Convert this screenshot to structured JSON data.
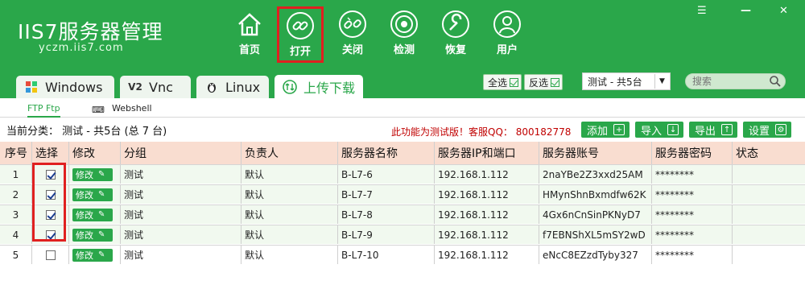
{
  "app": {
    "logo_main": "IIS7服务器管理",
    "logo_sub": "yczm.iis7.com"
  },
  "nav": [
    {
      "label": "首页",
      "icon": "home-icon"
    },
    {
      "label": "打开",
      "icon": "link-icon"
    },
    {
      "label": "关闭",
      "icon": "broken-link-icon"
    },
    {
      "label": "检测",
      "icon": "target-icon"
    },
    {
      "label": "恢复",
      "icon": "wrench-icon"
    },
    {
      "label": "用户",
      "icon": "user-icon"
    }
  ],
  "window": {
    "menu": "☰",
    "minimize": "—",
    "close": "✕"
  },
  "tabs": [
    {
      "label": "Windows",
      "icon": "windows-icon"
    },
    {
      "label": "Vnc",
      "icon": "vnc-icon"
    },
    {
      "label": "Linux",
      "icon": "linux-icon"
    },
    {
      "label": "上传下载",
      "icon": "upload-download-icon"
    }
  ],
  "toolbar": {
    "select_all": "全选",
    "invert": "反选",
    "group_select": "测试 - 共5台",
    "search_placeholder": "搜索"
  },
  "subtabs": [
    {
      "label": "FTP  Ftp"
    },
    {
      "label": "Webshell"
    }
  ],
  "info": {
    "category": "当前分类：  测试 - 共5台 (总 7 台)",
    "notice": "此功能为测试版！客服QQ：  800182778"
  },
  "actions": [
    {
      "label": "添加",
      "icon": "+"
    },
    {
      "label": "导入",
      "icon": "↓"
    },
    {
      "label": "导出",
      "icon": "↑"
    },
    {
      "label": "设置",
      "icon": "⚙"
    }
  ],
  "columns": [
    "序号",
    "选择",
    "修改",
    "分组",
    "负责人",
    "服务器名称",
    "服务器IP和端口",
    "服务器账号",
    "服务器密码",
    "状态"
  ],
  "edit_label": "修改",
  "rows": [
    {
      "num": "1",
      "checked": true,
      "group": "测试",
      "owner": "默认",
      "name": "B-L7-6",
      "ip": "192.168.1.112",
      "account": "2naYBe2Z3xxd25AM",
      "password": "********",
      "status": ""
    },
    {
      "num": "2",
      "checked": true,
      "group": "测试",
      "owner": "默认",
      "name": "B-L7-7",
      "ip": "192.168.1.112",
      "account": "HMynShnBxmdfw62K",
      "password": "********",
      "status": ""
    },
    {
      "num": "3",
      "checked": true,
      "group": "测试",
      "owner": "默认",
      "name": "B-L7-8",
      "ip": "192.168.1.112",
      "account": "4Gx6nCnSinPKNyD7",
      "password": "********",
      "status": ""
    },
    {
      "num": "4",
      "checked": true,
      "group": "测试",
      "owner": "默认",
      "name": "B-L7-9",
      "ip": "192.168.1.112",
      "account": "f7EBNShXL5mSY2wD",
      "password": "********",
      "status": ""
    },
    {
      "num": "5",
      "checked": false,
      "group": "测试",
      "owner": "默认",
      "name": "B-L7-10",
      "ip": "192.168.1.112",
      "account": "eNcC8EZzdTyby327",
      "password": "********",
      "status": ""
    }
  ],
  "colors": {
    "brand_green": "#2aa74a",
    "header_row": "#f9ddd0",
    "row_tint": "#f1f9ef",
    "highlight_red": "#e02020",
    "notice_red": "#c00000"
  }
}
